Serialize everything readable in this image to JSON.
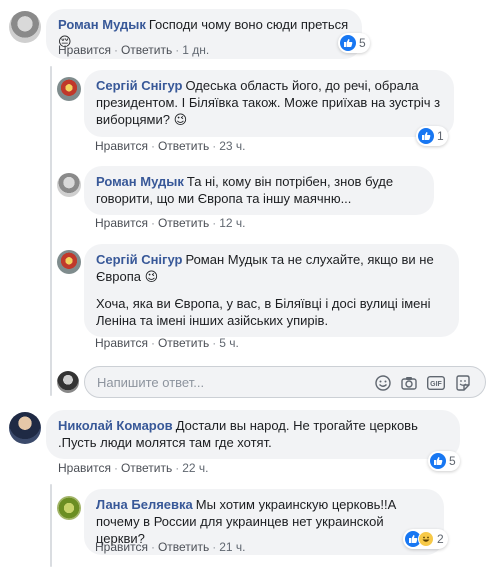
{
  "actions": {
    "like": "Нравится",
    "reply": "Ответить",
    "like_uk": "Нравится",
    "reply_uk": "Ответить"
  },
  "comments": [
    {
      "author": "Роман Мудык",
      "text": "Господи чому воно сюди преться",
      "emoji": "😔",
      "time": "1 дн.",
      "reactions": "5"
    },
    {
      "author": "Сергій Снігур",
      "text": "Одеська область його, до речі, обрала президентом. І Біляївка також. Може приїхав на зустріч з виборцями?",
      "emoji": "😉",
      "time": "23 ч.",
      "reactions": "1"
    },
    {
      "author": "Роман Мудык",
      "text": "Та ні, кому він потрібен, знов буде говорити, що ми Європа та іншу маячню...",
      "time": "12 ч."
    },
    {
      "author": "Сергій Снігур",
      "text": "Роман Мудык та не слухайте, якщо ви не Європа",
      "emoji": "😉",
      "text2": "Хоча, яка ви Європа, у вас, в Біляївці і досі вулиці імені Леніна та імені інших азійських упирів.",
      "time": "5 ч."
    },
    {
      "author": "Николай Комаров",
      "text": "Достали вы народ. Не трогайте церковь .Пусть люди молятся там где хотят.",
      "time": "22 ч.",
      "reactions": "5"
    },
    {
      "author": "Лана Беляевка",
      "text": "Мы хотим украинскую церковь!!А почему в России для украинцев нет украинской церкви?",
      "time": "21 ч.",
      "reactions": "2"
    }
  ],
  "reply_box": {
    "placeholder": "Напишите ответ..."
  },
  "icons": {
    "emoji": "smiley-icon",
    "camera": "camera-icon",
    "gif": "gif-icon",
    "sticker": "sticker-icon",
    "like": "like-icon",
    "haha": "haha-icon"
  },
  "colors": {
    "author": "#385898",
    "bubble": "#f2f3f5",
    "like_blue": "#1877f2"
  }
}
